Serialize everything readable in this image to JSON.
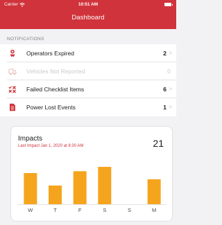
{
  "status_bar": {
    "carrier": "Carrier",
    "time": "10:51 AM"
  },
  "header": {
    "title": "Dashboard"
  },
  "notifications": {
    "section_label": "NOTIFICATIONS",
    "items": [
      {
        "label": "Operators Expired",
        "count": "2",
        "icon": "person-badge-icon",
        "enabled": true
      },
      {
        "label": "Vehicles Not Reported",
        "count": "0",
        "icon": "vehicle-icon",
        "enabled": false
      },
      {
        "label": "Failed Checklist Items",
        "count": "6",
        "icon": "failed-checklist-icon",
        "enabled": true
      },
      {
        "label": "Power Lost Events",
        "count": "1",
        "icon": "document-icon",
        "enabled": true
      }
    ]
  },
  "impacts_card": {
    "title": "Impacts",
    "subtitle": "Last Impact Jan 1, 2020 at 8:30 AM",
    "total": "21"
  },
  "colors": {
    "brand_red": "#d0333b",
    "bar_orange": "#f5a51d"
  },
  "chart_data": {
    "type": "bar",
    "categories": [
      "W",
      "T",
      "F",
      "S",
      "S",
      "M"
    ],
    "values": [
      5,
      3,
      5.3,
      6,
      0,
      4
    ],
    "ylim": [
      0,
      8
    ],
    "grid": false,
    "legend": "none"
  }
}
